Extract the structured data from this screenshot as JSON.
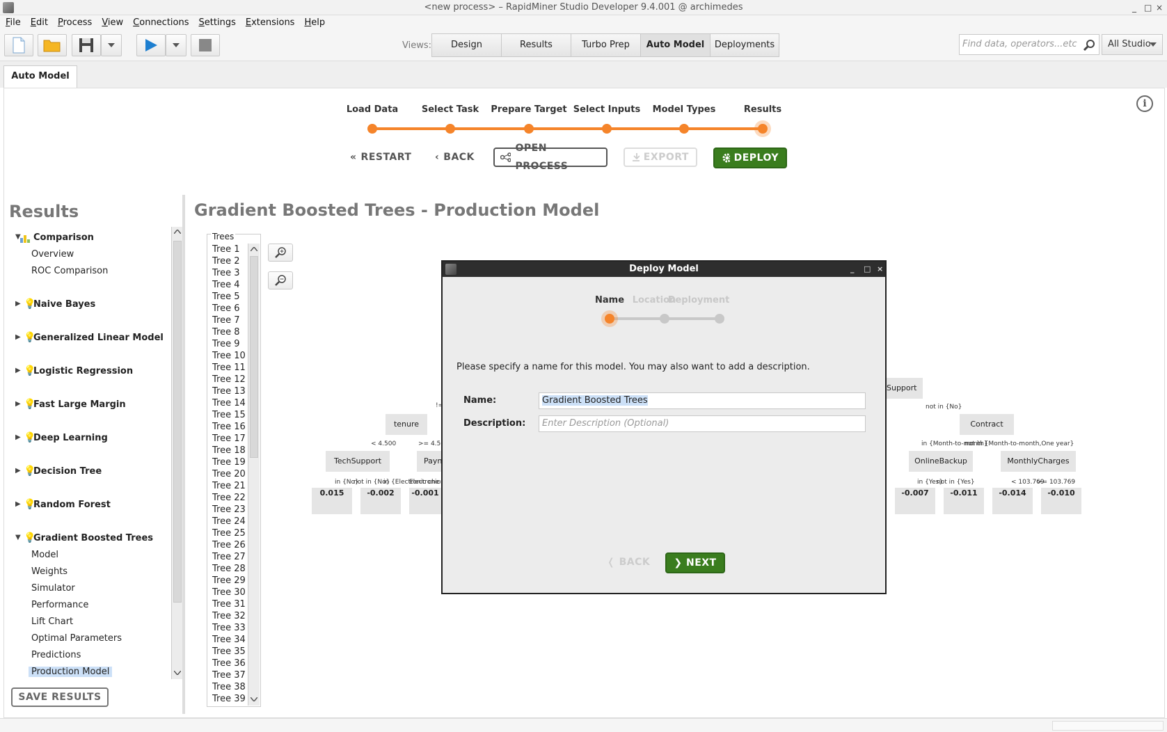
{
  "window": {
    "title": "<new process> – RapidMiner Studio Developer 9.4.001 @ archimedes",
    "controls": [
      "_",
      "□",
      "×"
    ]
  },
  "menu": [
    "File",
    "Edit",
    "Process",
    "View",
    "Connections",
    "Settings",
    "Extensions",
    "Help"
  ],
  "toolbar": {
    "views_label": "Views:",
    "views": [
      "Design",
      "Results",
      "Turbo Prep",
      "Auto Model",
      "Deployments"
    ],
    "active_view": "Auto Model",
    "search_placeholder": "Find data, operators...etc",
    "scope": "All Studio"
  },
  "doc_tab": "Auto Model",
  "stepper": {
    "steps": [
      "Load Data",
      "Select Task",
      "Prepare Target",
      "Select Inputs",
      "Model Types",
      "Results"
    ],
    "current": "Results"
  },
  "actions": {
    "restart": "RESTART",
    "back": "BACK",
    "open_process": "OPEN PROCESS",
    "export": "EXPORT",
    "deploy": "DEPLOY"
  },
  "results_panel": {
    "title": "Results",
    "groups": [
      {
        "label": "Comparison",
        "expanded": true,
        "icon": "chart-icon",
        "children": [
          "Overview",
          "ROC Comparison"
        ]
      },
      {
        "label": "Naive Bayes",
        "expanded": false,
        "icon": "bulb-icon",
        "children": []
      },
      {
        "label": "Generalized Linear Model",
        "expanded": false,
        "icon": "bulb-icon",
        "children": []
      },
      {
        "label": "Logistic Regression",
        "expanded": false,
        "icon": "bulb-icon",
        "children": []
      },
      {
        "label": "Fast Large Margin",
        "expanded": false,
        "icon": "bulb-icon",
        "children": []
      },
      {
        "label": "Deep Learning",
        "expanded": false,
        "icon": "bulb-icon",
        "children": []
      },
      {
        "label": "Decision Tree",
        "expanded": false,
        "icon": "bulb-icon",
        "children": []
      },
      {
        "label": "Random Forest",
        "expanded": false,
        "icon": "bulb-icon",
        "children": []
      },
      {
        "label": "Gradient Boosted Trees",
        "expanded": true,
        "icon": "bulb-icon",
        "children": [
          "Model",
          "Weights",
          "Simulator",
          "Performance",
          "Lift Chart",
          "Optimal Parameters",
          "Predictions",
          "Production Model"
        ]
      }
    ],
    "selected": "Production Model",
    "save_button": "SAVE RESULTS"
  },
  "main": {
    "title": "Gradient Boosted Trees - Production Model",
    "trees_legend": "Trees",
    "trees": [
      "Tree 1",
      "Tree 2",
      "Tree 3",
      "Tree 4",
      "Tree 5",
      "Tree 6",
      "Tree 7",
      "Tree 8",
      "Tree 9",
      "Tree 10",
      "Tree 11",
      "Tree 12",
      "Tree 13",
      "Tree 14",
      "Tree 15",
      "Tree 16",
      "Tree 17",
      "Tree 18",
      "Tree 19",
      "Tree 20",
      "Tree 21",
      "Tree 22",
      "Tree 23",
      "Tree 24",
      "Tree 25",
      "Tree 26",
      "Tree 27",
      "Tree 28",
      "Tree 29",
      "Tree 30",
      "Tree 31",
      "Tree 32",
      "Tree 33",
      "Tree 34",
      "Tree 35",
      "Tree 36",
      "Tree 37",
      "Tree 38",
      "Tree 39"
    ],
    "graph": {
      "nodes": {
        "tenure": "tenure",
        "techsupport": "TechSupport",
        "payment": "Payn",
        "support": "Support",
        "contract": "Contract",
        "onlinebackup": "OnlineBackup",
        "monthlycharges": "MonthlyCharges"
      },
      "edges": {
        "bang": "!=",
        "lt4500": "< 4.500",
        "ge4500": ">= 4.500",
        "in_no": "in {No}",
        "notin_no": "not in {No}",
        "electronic": "in {Electronic check}",
        "elec2": "Electronic check",
        "support_notin": "not in {No}",
        "contract_in": "in {Month-to-month}",
        "contract_notin": "not in {Month-to-month,One year}",
        "ob_in": "in {Yes}",
        "ob_notin": "not in {Yes}",
        "mc_lt": "< 103.769",
        "mc_ge": ">= 103.769"
      },
      "leaves": [
        "0.015",
        "-0.002",
        "-0.001",
        "-0.007",
        "-0.011",
        "-0.014",
        "-0.010"
      ]
    }
  },
  "deploy_dialog": {
    "title": "Deploy Model",
    "steps": [
      "Name",
      "Location",
      "Deployment"
    ],
    "instruction": "Please specify a name for this model. You may also want to add a description.",
    "name_label": "Name:",
    "name_value": "Gradient Boosted Trees",
    "description_label": "Description:",
    "description_placeholder": "Enter Description (Optional)",
    "back": "BACK",
    "next": "NEXT"
  }
}
